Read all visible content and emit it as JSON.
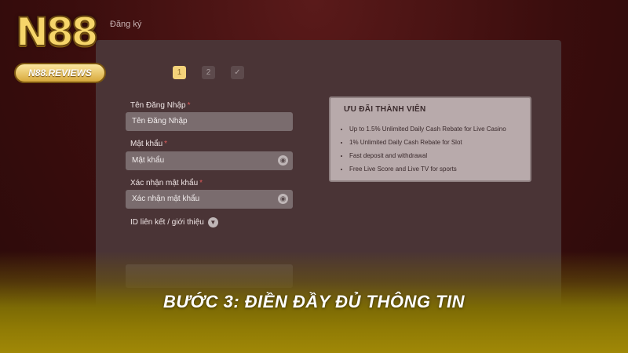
{
  "logo": {
    "brand": "N88",
    "badge": "N88.REVIEWS"
  },
  "header": {
    "link": "Đăng ký"
  },
  "steps": [
    {
      "label": "1",
      "active": true
    },
    {
      "label": "2",
      "active": false
    },
    {
      "label": "✓",
      "active": false
    }
  ],
  "form": {
    "username": {
      "label": "Tên Đăng Nhập",
      "placeholder": "Tên Đăng Nhập"
    },
    "password": {
      "label": "Mật khẩu",
      "placeholder": "Mật khẩu"
    },
    "confirm": {
      "label": "Xác nhận mật khẩu",
      "placeholder": "Xác nhận mật khẩu"
    },
    "referral": {
      "label": "ID liên kết / giới thiệu"
    }
  },
  "benefits": {
    "title": "ƯU ĐÃI THÀNH VIÊN",
    "items": [
      "Up to 1.5% Unlimited Daily Cash Rebate for Live Casino",
      "1% Unlimited Daily Cash Rebate for Slot",
      "Fast deposit and withdrawal",
      "Free Live Score and Live TV for sports"
    ]
  },
  "caption": "BƯỚC 3: ĐIỀN ĐẦY ĐỦ THÔNG TIN",
  "colors": {
    "accent": "#f3d27a",
    "background": "#3a0d0d",
    "panel": "#4a3436",
    "caption_bar": "#8f7a05"
  }
}
